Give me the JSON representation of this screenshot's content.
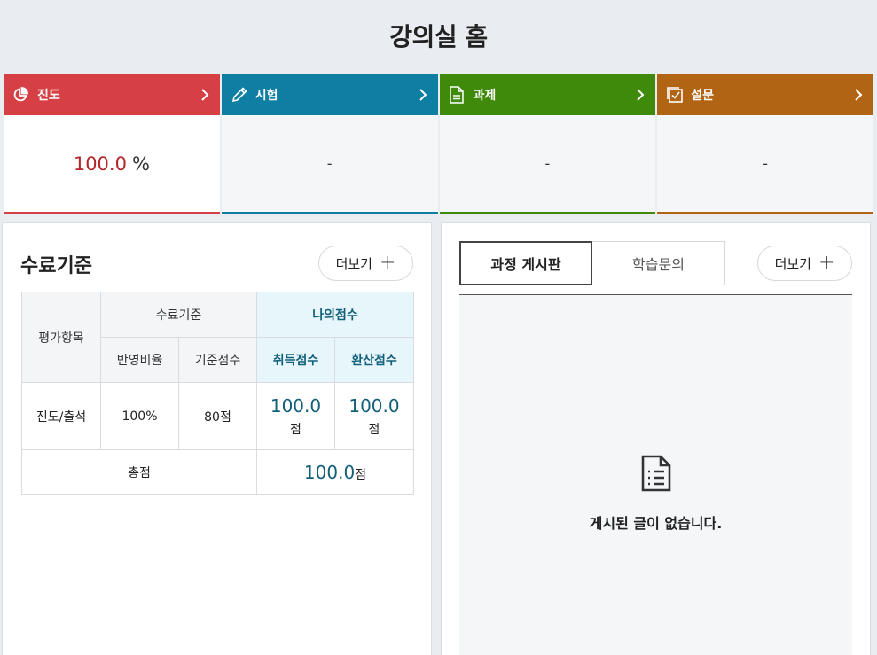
{
  "page": {
    "title": "강의실 홈"
  },
  "summary_cards": [
    {
      "label": "진도",
      "value": "100.0",
      "unit": "%",
      "icon": "pie-chart-icon",
      "color": "#d64045"
    },
    {
      "label": "시험",
      "value": "-",
      "icon": "pencil-icon",
      "color": "#0e7ea3"
    },
    {
      "label": "과제",
      "value": "-",
      "icon": "document-icon",
      "color": "#3f8a0a"
    },
    {
      "label": "설문",
      "value": "-",
      "icon": "checkbox-icon",
      "color": "#b06414"
    }
  ],
  "criteria": {
    "title": "수료기준",
    "more_label": "더보기",
    "headers": {
      "item": "평가항목",
      "standard": "수료기준",
      "my_score": "나의점수",
      "ratio": "반영비율",
      "base_score": "기준점수",
      "earned": "취득점수",
      "converted": "환산점수"
    },
    "rows": [
      {
        "item": "진도/출석",
        "ratio": "100%",
        "base": "80점",
        "earned": "100.0",
        "earned_unit": "점",
        "converted": "100.0",
        "converted_unit": "점"
      }
    ],
    "total": {
      "label": "총점",
      "value": "100.0",
      "unit": "점"
    }
  },
  "board": {
    "tabs": [
      "과정 게시판",
      "학습문의"
    ],
    "active_tab": 0,
    "more_label": "더보기",
    "empty_message": "게시된 글이 없습니다."
  }
}
